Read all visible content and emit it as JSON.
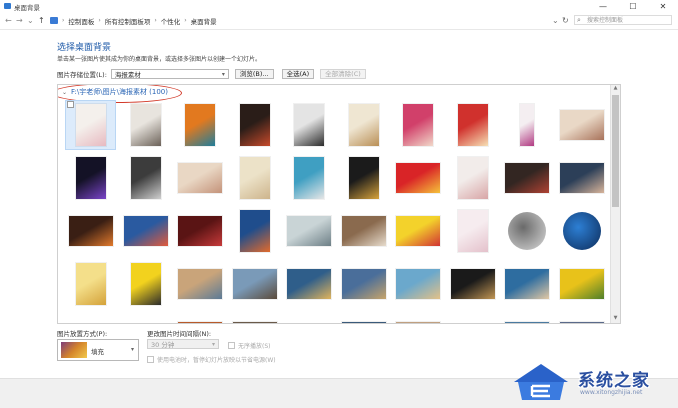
{
  "window": {
    "title": "桌面背景",
    "buttons": {
      "minimize": "—",
      "maximize": "☐",
      "close": "✕"
    }
  },
  "address": {
    "back": "←",
    "forward": "→",
    "recent": "⌄",
    "up": "↑",
    "crumbs": [
      "控制面板",
      "所有控制面板项",
      "个性化",
      "桌面背景"
    ],
    "refresh": "↻",
    "search_placeholder": "搜索控制面板"
  },
  "main": {
    "heading": "选择桌面背景",
    "description": "单击某一张图片使其成为你的桌面背景，或选择多张图片以创建一个幻灯片。",
    "location_label": "图片存储位置(L):",
    "location_value": "海报素材",
    "browse_button": "浏览(B)...",
    "select_all_button": "全选(A)",
    "clear_all_button": "全部清除(C)"
  },
  "gallery": {
    "group_label": "F:\\宇老师\\图片\\海报素材 (100)",
    "thumbs": [
      {
        "c1": "#f4f0ec",
        "c2": "#e7b9c0",
        "row": 0,
        "col": 0,
        "shape": "p",
        "selected": true
      },
      {
        "c1": "#e8e4de",
        "c2": "#6b6158",
        "row": 0,
        "col": 1,
        "shape": "p"
      },
      {
        "c1": "#e2791f",
        "c2": "#1f7d9a",
        "row": 0,
        "col": 2,
        "shape": "p"
      },
      {
        "c1": "#2a1d18",
        "c2": "#c74a2b",
        "row": 0,
        "col": 3,
        "shape": "p"
      },
      {
        "c1": "#e4e4e4",
        "c2": "#2b2b2b",
        "row": 0,
        "col": 4,
        "shape": "p"
      },
      {
        "c1": "#efe6d2",
        "c2": "#b98f56",
        "row": 0,
        "col": 5,
        "shape": "p"
      },
      {
        "c1": "#d1406a",
        "c2": "#f1d8c9",
        "row": 0,
        "col": 6,
        "shape": "p"
      },
      {
        "c1": "#d0312d",
        "c2": "#f6e0b5",
        "row": 0,
        "col": 7,
        "shape": "p"
      },
      {
        "c1": "#f4eef1",
        "c2": "#b13a82",
        "row": 0,
        "col": 8,
        "shape": "t"
      },
      {
        "c1": "#e9d8c6",
        "c2": "#a8725a",
        "row": 0,
        "col": 9,
        "shape": "l"
      },
      {
        "c1": "#141226",
        "c2": "#7a44c9",
        "row": 1,
        "col": 0,
        "shape": "p"
      },
      {
        "c1": "#3c3c3c",
        "c2": "#cfcfcf",
        "row": 1,
        "col": 1,
        "shape": "p"
      },
      {
        "c1": "#e9d7c4",
        "c2": "#c4937a",
        "row": 1,
        "col": 2,
        "shape": "l"
      },
      {
        "c1": "#ece2c8",
        "c2": "#cdb48c",
        "row": 1,
        "col": 3,
        "shape": "p"
      },
      {
        "c1": "#3f9fc2",
        "c2": "#e6e6e6",
        "row": 1,
        "col": 4,
        "shape": "p"
      },
      {
        "c1": "#1b1b1b",
        "c2": "#d7a33b",
        "row": 1,
        "col": 5,
        "shape": "p"
      },
      {
        "c1": "#d92427",
        "c2": "#f5c23a",
        "row": 1,
        "col": 6,
        "shape": "l"
      },
      {
        "c1": "#f2ecea",
        "c2": "#d8a5a6",
        "row": 1,
        "col": 7,
        "shape": "p"
      },
      {
        "c1": "#332622",
        "c2": "#b04233",
        "row": 1,
        "col": 8,
        "shape": "l"
      },
      {
        "c1": "#2c3f58",
        "c2": "#d8b49a",
        "row": 1,
        "col": 9,
        "shape": "l"
      },
      {
        "c1": "#3a1f14",
        "c2": "#e27a2c",
        "row": 2,
        "col": 0,
        "shape": "l"
      },
      {
        "c1": "#2a5aa0",
        "c2": "#e25a3c",
        "row": 2,
        "col": 1,
        "shape": "l"
      },
      {
        "c1": "#5a1414",
        "c2": "#c73a3a",
        "row": 2,
        "col": 2,
        "shape": "l"
      },
      {
        "c1": "#1f4d8c",
        "c2": "#e26a2c",
        "row": 2,
        "col": 3,
        "shape": "p"
      },
      {
        "c1": "#c9d4d6",
        "c2": "#6d7f86",
        "row": 2,
        "col": 4,
        "shape": "l"
      },
      {
        "c1": "#8a6a4e",
        "c2": "#e7dccd",
        "row": 2,
        "col": 5,
        "shape": "l"
      },
      {
        "c1": "#f3d22b",
        "c2": "#d13333",
        "row": 2,
        "col": 6,
        "shape": "l"
      },
      {
        "c1": "#f6ecef",
        "c2": "#e4c1cb",
        "row": 2,
        "col": 7,
        "shape": "p"
      },
      {
        "c1": "#d9d9d9",
        "c2": "#6a6a6a",
        "row": 2,
        "col": 8,
        "shape": "s"
      },
      {
        "c1": "#0d2c5a",
        "c2": "#2d7fd4",
        "row": 2,
        "col": 9,
        "shape": "s"
      },
      {
        "c1": "#f4df8a",
        "c2": "#d4a23a",
        "row": 3,
        "col": 0,
        "shape": "p"
      },
      {
        "c1": "#f2d21e",
        "c2": "#2b2b2b",
        "row": 3,
        "col": 1,
        "shape": "p"
      },
      {
        "c1": "#c9a47a",
        "c2": "#5b7a96",
        "row": 3,
        "col": 2,
        "shape": "l"
      },
      {
        "c1": "#7a9ab8",
        "c2": "#5a4a3a",
        "row": 3,
        "col": 3,
        "shape": "l"
      },
      {
        "c1": "#2f5e8a",
        "c2": "#e0b45c",
        "row": 3,
        "col": 4,
        "shape": "l"
      },
      {
        "c1": "#4a6e9a",
        "c2": "#c7a46a",
        "row": 3,
        "col": 5,
        "shape": "l"
      },
      {
        "c1": "#6ba8cc",
        "c2": "#e3c188",
        "row": 3,
        "col": 6,
        "shape": "l"
      },
      {
        "c1": "#1a1a1a",
        "c2": "#c29654",
        "row": 3,
        "col": 7,
        "shape": "l"
      },
      {
        "c1": "#2e6da0",
        "c2": "#e2c8a4",
        "row": 3,
        "col": 8,
        "shape": "l"
      },
      {
        "c1": "#e8c21a",
        "c2": "#4e7f2a",
        "row": 3,
        "col": 9,
        "shape": "l"
      },
      {
        "c1": "#b85a2a",
        "c2": "#f0b060",
        "row": 4,
        "col": 2,
        "shape": "l"
      },
      {
        "c1": "#6a5a4a",
        "c2": "#d8c8b0",
        "row": 4,
        "col": 3,
        "shape": "l"
      },
      {
        "c1": "#3a5a7a",
        "c2": "#c8b090",
        "row": 4,
        "col": 5,
        "shape": "l"
      },
      {
        "c1": "#c0a080",
        "c2": "#7a5a40",
        "row": 4,
        "col": 6,
        "shape": "l"
      },
      {
        "c1": "#4a7aa0",
        "c2": "#e0d0b0",
        "row": 4,
        "col": 8,
        "shape": "l"
      },
      {
        "c1": "#5a6a8a",
        "c2": "#d0b090",
        "row": 4,
        "col": 9,
        "shape": "l"
      }
    ]
  },
  "options": {
    "fit_label": "图片放置方式(P):",
    "fit_value": "填充",
    "interval_label": "更改图片时间间隔(N):",
    "interval_value": "30 分钟",
    "shuffle_label": "无序播放(S)",
    "battery_label": "使用电池时，暂停幻灯片放映以节省电源(W)"
  },
  "watermark": {
    "brand": "系统之家",
    "url": "www.xitongzhijia.net"
  },
  "colors": {
    "heading": "#1e5aa8",
    "annotation": "#d23a2a"
  }
}
